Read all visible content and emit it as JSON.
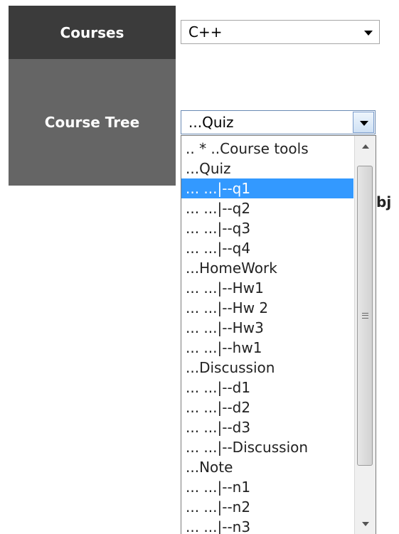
{
  "labels": {
    "courses": "Courses",
    "course_tree": "Course Tree"
  },
  "courses_select": {
    "value": "C++"
  },
  "tree_select": {
    "value": "...Quiz"
  },
  "dropdown": {
    "items": [
      ".. * ..Course tools",
      "...Quiz",
      "... ...|--q1",
      "... ...|--q2",
      "... ...|--q3",
      "... ...|--q4",
      "...HomeWork",
      "... ...|--Hw1",
      "... ...|--Hw 2",
      "... ...|--Hw3",
      "... ...|--hw1",
      "...Discussion",
      "... ...|--d1",
      "... ...|--d2",
      "... ...|--d3",
      "... ...|--Discussion",
      "...Note",
      "... ...|--n1",
      "... ...|--n2",
      "... ...|--n3"
    ],
    "selected_index": 2
  },
  "partial_text": "bj",
  "colors": {
    "courses_bg": "#3b3b3b",
    "tree_bg": "#656565",
    "selection": "#3399ff"
  }
}
